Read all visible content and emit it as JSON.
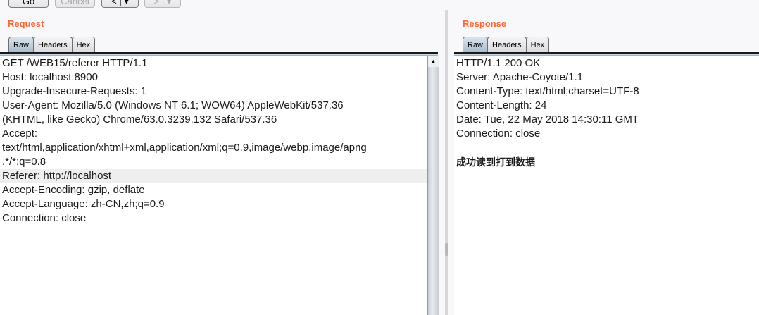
{
  "toolbar": {
    "go": "Go",
    "cancel": "Cancel",
    "back": "<",
    "forward": ">"
  },
  "request": {
    "title": "Request",
    "tabs": [
      "Raw",
      "Headers",
      "Hex"
    ],
    "active_tab": "Raw",
    "lines": [
      {
        "text": "GET /WEB15/referer HTTP/1.1"
      },
      {
        "text": "Host: localhost:8900"
      },
      {
        "text": "Upgrade-Insecure-Requests: 1"
      },
      {
        "text": "User-Agent: Mozilla/5.0 (Windows NT 6.1; WOW64) AppleWebKit/537.36"
      },
      {
        "text": "(KHTML, like Gecko) Chrome/63.0.3239.132 Safari/537.36"
      },
      {
        "text": "Accept:"
      },
      {
        "text": "text/html,application/xhtml+xml,application/xml;q=0.9,image/webp,image/apng"
      },
      {
        "text": ",*/*;q=0.8"
      },
      {
        "text": "Referer: http://localhost",
        "highlighted": true
      },
      {
        "text": "Accept-Encoding: gzip, deflate"
      },
      {
        "text": "Accept-Language: zh-CN,zh;q=0.9"
      },
      {
        "text": "Connection: close"
      }
    ]
  },
  "response": {
    "title": "Response",
    "tabs": [
      "Raw",
      "Headers",
      "Hex"
    ],
    "active_tab": "Raw",
    "lines": [
      "HTTP/1.1 200 OK",
      "Server: Apache-Coyote/1.1",
      "Content-Type: text/html;charset=UTF-8",
      "Content-Length: 24",
      "Date: Tue, 22 May 2018 14:30:11 GMT",
      "Connection: close",
      ""
    ],
    "body": "成功读到打到数据"
  }
}
